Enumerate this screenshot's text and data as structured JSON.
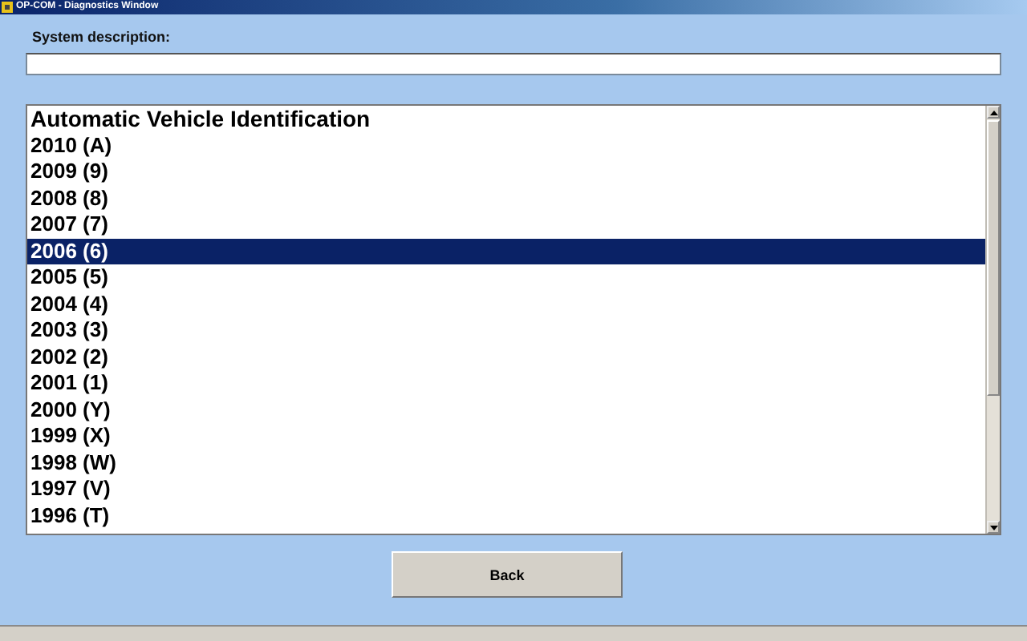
{
  "window": {
    "title": "OP-COM - Diagnostics Window"
  },
  "system_description": {
    "label": "System description:"
  },
  "list": {
    "items": [
      {
        "text": "Automatic Vehicle Identification",
        "kind": "heading",
        "selected": false
      },
      {
        "text": "2010 (A)",
        "kind": "item",
        "selected": false
      },
      {
        "text": "2009 (9)",
        "kind": "item",
        "selected": false
      },
      {
        "text": "2008 (8)",
        "kind": "item",
        "selected": false
      },
      {
        "text": "2007 (7)",
        "kind": "item",
        "selected": false
      },
      {
        "text": "2006 (6)",
        "kind": "item",
        "selected": true
      },
      {
        "text": "2005 (5)",
        "kind": "item",
        "selected": false
      },
      {
        "text": "2004 (4)",
        "kind": "item",
        "selected": false
      },
      {
        "text": "2003 (3)",
        "kind": "item",
        "selected": false
      },
      {
        "text": "2002 (2)",
        "kind": "item",
        "selected": false
      },
      {
        "text": "2001 (1)",
        "kind": "item",
        "selected": false
      },
      {
        "text": "2000 (Y)",
        "kind": "item",
        "selected": false
      },
      {
        "text": "1999 (X)",
        "kind": "item",
        "selected": false
      },
      {
        "text": "1998 (W)",
        "kind": "item",
        "selected": false
      },
      {
        "text": "1997 (V)",
        "kind": "item",
        "selected": false
      },
      {
        "text": "1996 (T)",
        "kind": "item",
        "selected": false
      }
    ]
  },
  "buttons": [
    "Back"
  ]
}
